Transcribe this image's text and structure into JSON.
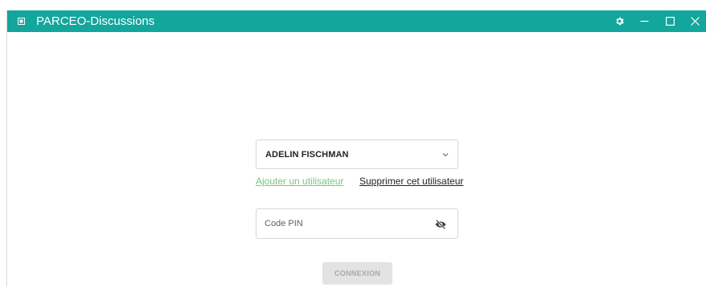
{
  "window": {
    "title": "PARCEO-Discussions",
    "accent_color": "#12a69c",
    "controls": {
      "settings_icon": "gear-icon",
      "minimize_icon": "minimize-icon",
      "maximize_icon": "maximize-icon",
      "close_icon": "close-icon"
    }
  },
  "login": {
    "selected_user": "ADELIN FISCHMAN",
    "add_user_link": "Ajouter un utilisateur",
    "remove_user_link": "Supprimer cet utilisateur",
    "pin_placeholder": "Code PIN",
    "pin_value": "",
    "toggle_visibility_icon": "eye-off-icon",
    "connect_button": "CONNEXION",
    "link_color": "#7bc47f"
  }
}
